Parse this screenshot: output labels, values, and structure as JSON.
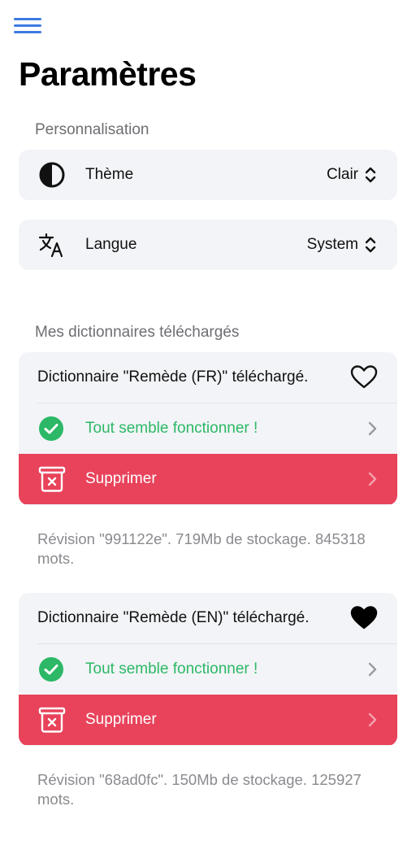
{
  "header": {
    "title": "Paramètres"
  },
  "personalisation": {
    "section_label": "Personnalisation",
    "theme": {
      "label": "Thème",
      "value": "Clair"
    },
    "language": {
      "label": "Langue",
      "value": "System"
    }
  },
  "dictionaries": {
    "section_label": "Mes dictionnaires téléchargés",
    "items": [
      {
        "title": "Dictionnaire \"Remède (FR)\" téléchargé.",
        "favorite": false,
        "status": "Tout semble fonctionner !",
        "delete_label": "Supprimer",
        "footnote": "Révision \"991122e\". 719Mb de stockage. 845318 mots."
      },
      {
        "title": "Dictionnaire \"Remède (EN)\" téléchargé.",
        "favorite": true,
        "status": "Tout semble fonctionner !",
        "delete_label": "Supprimer",
        "footnote": "Révision \"68ad0fc\". 150Mb de stockage. 125927 mots."
      }
    ]
  },
  "colors": {
    "accent": "#3d7be0",
    "success": "#2cb866",
    "danger": "#e8435b",
    "card_bg": "#f3f4f7"
  }
}
